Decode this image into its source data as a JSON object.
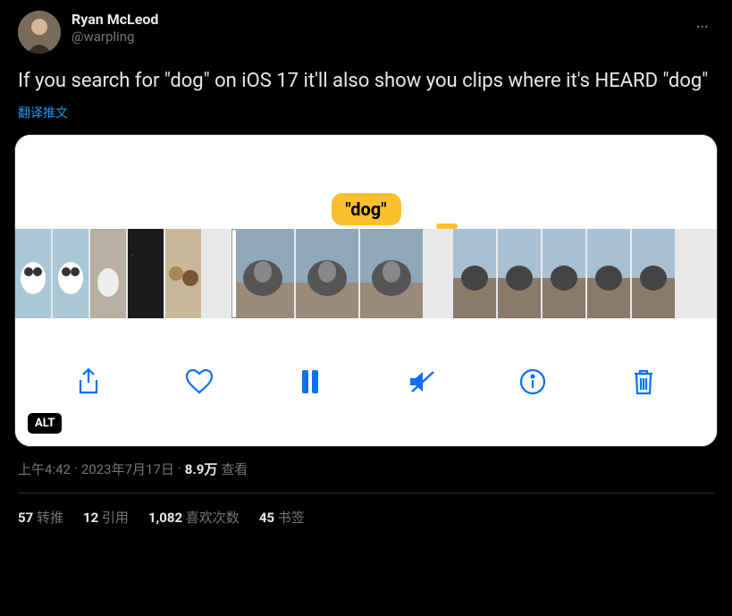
{
  "author": {
    "display_name": "Ryan McLeod",
    "handle": "@warpling"
  },
  "more_icon": "…",
  "body": "If you search for \"dog\" on iOS 17 it'll also show you clips where it's HEARD \"dog\"",
  "translate": "翻译推文",
  "media": {
    "badge": "\"dog\"",
    "alt_label": "ALT",
    "controls": [
      "share",
      "like",
      "pause",
      "mute",
      "info",
      "delete"
    ]
  },
  "meta": {
    "time": "上午4:42",
    "separator": "·",
    "date": "2023年7月17日",
    "views_count": "8.9万",
    "views_label": "查看"
  },
  "stats": {
    "retweets": {
      "count": "57",
      "label": "转推"
    },
    "quotes": {
      "count": "12",
      "label": "引用"
    },
    "likes": {
      "count": "1,082",
      "label": "喜欢次数"
    },
    "bookmarks": {
      "count": "45",
      "label": "书签"
    }
  }
}
